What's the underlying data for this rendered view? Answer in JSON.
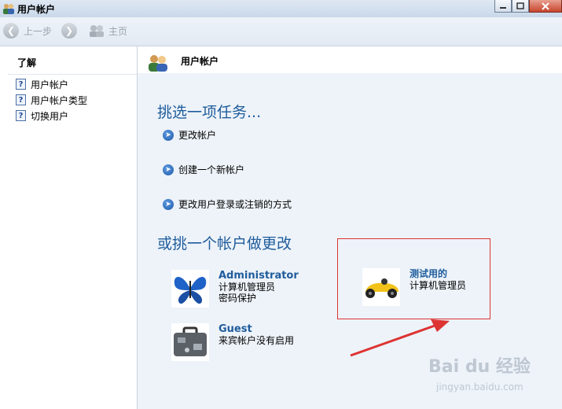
{
  "window": {
    "title": "用户帐户"
  },
  "toolbar": {
    "back_label": "上一步",
    "home_label": "主页"
  },
  "sidebar": {
    "heading": "了解",
    "items": [
      {
        "label": "用户帐户"
      },
      {
        "label": "用户帐户类型"
      },
      {
        "label": "切换用户"
      }
    ]
  },
  "main": {
    "header_title": "用户帐户",
    "tasks_heading": "挑选一项任务...",
    "tasks": [
      {
        "label": "更改帐户"
      },
      {
        "label": "创建一个新帐户"
      },
      {
        "label": "更改用户登录或注销的方式"
      }
    ],
    "accounts_heading": "或挑一个帐户做更改",
    "accounts": [
      {
        "name": "Administrator",
        "type": "计算机管理员",
        "status": "密码保护",
        "icon": "butterfly-icon"
      },
      {
        "name": "Guest",
        "type": "来宾帐户没有启用",
        "icon": "briefcase-icon"
      },
      {
        "name": "测试用的",
        "type": "计算机管理员",
        "icon": "race-car-icon"
      }
    ]
  },
  "watermark": {
    "text": "Bai du 经验",
    "subtext": "jingyan.baidu.com"
  },
  "colors": {
    "heading": "#1f5c9c",
    "annotation": "#d33"
  }
}
